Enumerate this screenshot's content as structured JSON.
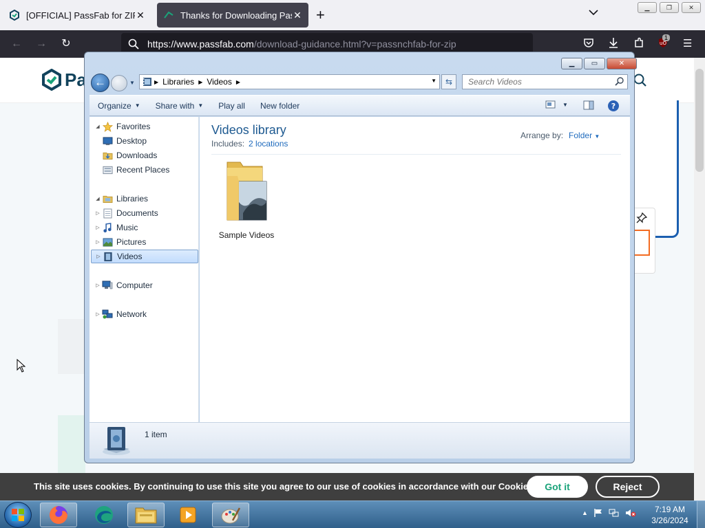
{
  "browser": {
    "tabs": [
      {
        "title": "[OFFICIAL] PassFab for ZIP - ZIP",
        "active": false
      },
      {
        "title": "Thanks for Downloading PassFab",
        "active": true
      }
    ],
    "url_domain": "https://www.passfab.com",
    "url_path": "/download-guidance.html?v=passnchfab-for-zip",
    "extension_badge": "1"
  },
  "page": {
    "logo_text": "Pa"
  },
  "explorer": {
    "breadcrumb": [
      "Libraries",
      "Videos"
    ],
    "search_placeholder": "Search Videos",
    "commands": {
      "organize": "Organize",
      "share_with": "Share with",
      "play_all": "Play all",
      "new_folder": "New folder"
    },
    "nav": {
      "favorites": "Favorites",
      "desktop": "Desktop",
      "downloads": "Downloads",
      "recent_places": "Recent Places",
      "libraries": "Libraries",
      "documents": "Documents",
      "music": "Music",
      "pictures": "Pictures",
      "videos": "Videos",
      "computer": "Computer",
      "network": "Network"
    },
    "library": {
      "title": "Videos library",
      "includes_label": "Includes:",
      "includes_link": "2 locations",
      "arrange_label": "Arrange by:",
      "arrange_value": "Folder"
    },
    "items": [
      {
        "name": "Sample Videos",
        "icon": "video-folder-icon"
      }
    ],
    "status": "1 item"
  },
  "cookie": {
    "message": "This site uses cookies. By continuing to use this site you agree to our use of cookies in accordance with our Cookie Policy",
    "accept": "Got it",
    "reject": "Reject"
  },
  "taskbar": {
    "time": "7:19 AM",
    "date": "3/26/2024"
  },
  "colors": {
    "accent_green": "#1aa37a",
    "browser_dark": "#2b2a33",
    "explorer_title": "#1e5a91"
  }
}
